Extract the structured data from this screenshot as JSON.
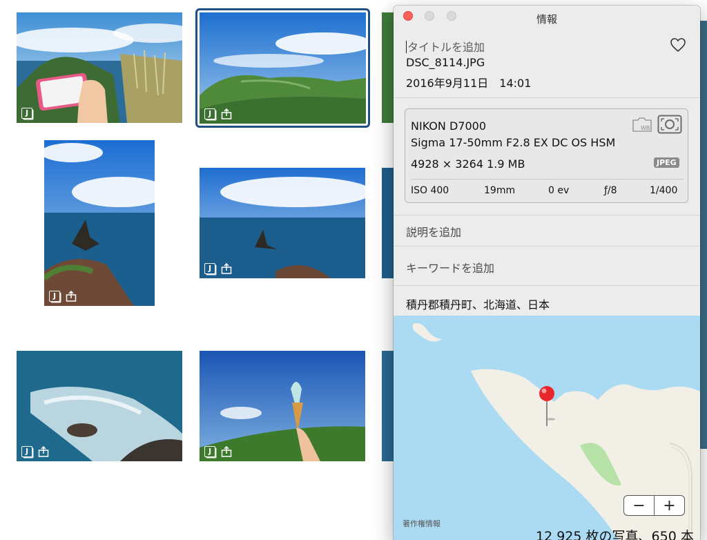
{
  "grid": {
    "badges": {
      "raw_label": "J"
    },
    "photos": [
      {
        "id": "p1",
        "scene": "hand-phone-cliff"
      },
      {
        "id": "p2",
        "scene": "green-hills-sky",
        "selected": true
      },
      {
        "id": "p3",
        "scene": "tall-rocks-sea"
      },
      {
        "id": "p4",
        "scene": "rocks-sea-wide"
      },
      {
        "id": "p5",
        "scene": "waves-rocks"
      },
      {
        "id": "p6",
        "scene": "ice-cream-sky"
      }
    ]
  },
  "info": {
    "window_title": "情報",
    "title_placeholder": "タイトルを追加",
    "filename": "DSC_8114.JPG",
    "datetime": "2016年9月11日　14:01",
    "camera": "NIKON D7000",
    "lens": "Sigma 17-50mm F2.8 EX DC OS HSM",
    "size": "4928 × 3264 1.9 MB",
    "format_badge": "JPEG",
    "wb_label": "WB",
    "exif": {
      "iso": "ISO 400",
      "focal": "19mm",
      "ev": "0 ev",
      "aperture": "ƒ/8",
      "shutter": "1/400"
    },
    "description_placeholder": "説明を追加",
    "keywords_placeholder": "キーワードを追加",
    "location": "積丹郡積丹町、北海道、日本",
    "map": {
      "zoom_out": "−",
      "zoom_in": "+",
      "copyright": "著作権情報"
    }
  },
  "status": {
    "text": "12 925 枚の写真、650 本"
  },
  "colors": {
    "selection": "#1e4e86",
    "close": "#fc5f57",
    "water": "#aadbf3",
    "land": "#f2efe6",
    "pin": "#e8262b"
  }
}
